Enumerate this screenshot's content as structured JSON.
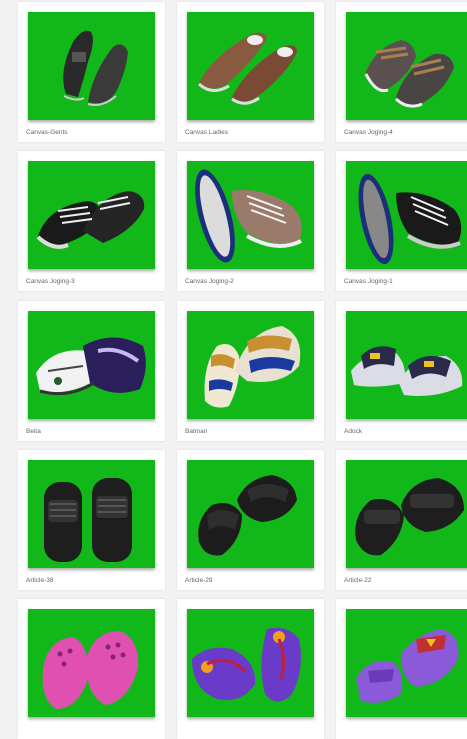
{
  "products": [
    {
      "name": "Canvas-Gents"
    },
    {
      "name": "Canvas Ladies"
    },
    {
      "name": "Canvas Joging-4"
    },
    {
      "name": "Canvas Joging-3"
    },
    {
      "name": "Canvas Joging-2"
    },
    {
      "name": "Canvas Joging-1"
    },
    {
      "name": "Beita"
    },
    {
      "name": "Batman"
    },
    {
      "name": "Adock"
    },
    {
      "name": "Article-38"
    },
    {
      "name": "Article-29"
    },
    {
      "name": "Article-22"
    },
    {
      "name": ""
    },
    {
      "name": ""
    },
    {
      "name": ""
    }
  ],
  "colors": {
    "photo_background": "#12b81a",
    "page_background": "#f3f3f3"
  }
}
